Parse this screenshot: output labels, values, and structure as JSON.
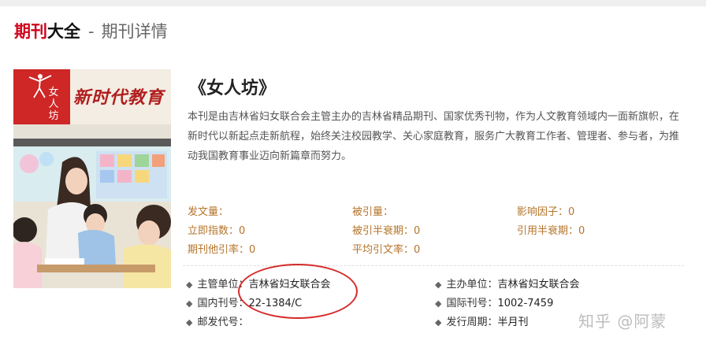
{
  "header": {
    "brand_part1": "期刊",
    "brand_part2": "大全",
    "separator": "-",
    "subtitle": "期刊详情"
  },
  "cover": {
    "side_label": "女人坊",
    "magazine_name": "新时代教育"
  },
  "journal": {
    "title": "《女人坊》",
    "description": "本刊是由吉林省妇女联合会主管主办的吉林省精品期刊、国家优秀刊物，作为人文教育领域内一面新旗帜，在新时代以新起点走新航程，始终关注校园教学、关心家庭教育，服务广大教育工作者、管理者、参与者，为推动我国教育事业迈向新篇章而努力。"
  },
  "stats": {
    "publications": "发文量：",
    "citations": "被引量：",
    "impact_factor": "影响因子：0",
    "immediacy_index": "立即指数：0",
    "cited_half_life": "被引半衰期：0",
    "citing_half_life": "引用半衰期：0",
    "other_citation_rate": "期刊他引率：0",
    "avg_citations": "平均引文率：0"
  },
  "info": {
    "supervisor_label": "主管单位：",
    "supervisor_value": "吉林省妇女联合会",
    "sponsor_label": "主办单位：",
    "sponsor_value": "吉林省妇女联合会",
    "cn_label": "国内刊号：",
    "cn_value": "22-1384/C",
    "issn_label": "国际刊号：",
    "issn_value": "1002-7459",
    "postal_label": "邮发代号：",
    "postal_value": "",
    "cycle_label": "发行周期：",
    "cycle_value": "半月刊"
  },
  "watermark": "知乎 @阿蒙",
  "colors": {
    "brand_red": "#d0021b",
    "stat_gold": "#b5742a",
    "annotation_red": "#d62b2b"
  }
}
